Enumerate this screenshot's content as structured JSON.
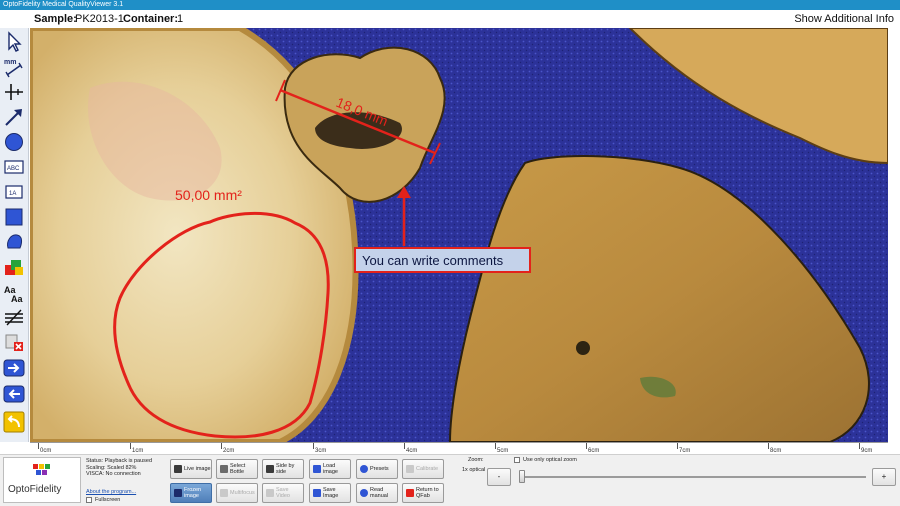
{
  "window": {
    "title": "OptoFidelity Medical QualityViewer 3.1"
  },
  "info": {
    "sample_label": "Sample:",
    "sample_value": "PK2013-1",
    "container_label": "Container:",
    "container_value": "1",
    "show_info": "Show Additional Info"
  },
  "toolbar": {
    "items": [
      {
        "icon": "pointer-icon"
      },
      {
        "icon": "measure-line-icon",
        "text": "mm"
      },
      {
        "icon": "crosshair-icon"
      },
      {
        "icon": "arrow-icon"
      },
      {
        "icon": "circle-icon"
      },
      {
        "icon": "text-box-icon",
        "text": "ABC"
      },
      {
        "icon": "label-icon",
        "text": "1A"
      },
      {
        "icon": "rectangle-icon"
      },
      {
        "icon": "freeform-icon"
      },
      {
        "icon": "layers-icon"
      },
      {
        "icon": "font-size-icon",
        "text": "Aa"
      },
      {
        "icon": "hatch-icon"
      },
      {
        "icon": "delete-icon"
      },
      {
        "icon": "forward-icon"
      },
      {
        "icon": "back-icon"
      },
      {
        "icon": "undo-icon"
      }
    ]
  },
  "annotations": {
    "area": "50,00 mm²",
    "length": "18,0 mm",
    "comment": "You can write comments"
  },
  "ruler": {
    "labels": [
      "0cm",
      "1cm",
      "2cm",
      "3cm",
      "4cm",
      "5cm",
      "6cm",
      "7cm",
      "8cm",
      "9cm"
    ]
  },
  "status": {
    "line1": "Status: Playback is paused",
    "line2": "Scaling: Scaled 82%",
    "line3": "VISCA: No connection",
    "about": "About the program...",
    "fullscreen": "Fullscreen"
  },
  "logo": {
    "text": "OptoFidelity"
  },
  "buttons": {
    "live_image": "Live image",
    "select_bottle": "Select Bottle",
    "side_by_side": "Side by side",
    "load_image": "Load image",
    "presets": "Presets",
    "calibrate": "Calibrate",
    "frozen_image": "Frozen image",
    "multifocus": "Multifocus",
    "save_video": "Save Video",
    "save_image": "Save Image",
    "read_manual": "Read manual",
    "return_qfab": "Return to QFab"
  },
  "zoom": {
    "label": "Zoom:",
    "value": "1x optical",
    "optical_only": "Use only optical zoom",
    "minus": "-",
    "plus": "+",
    "level": 0
  },
  "colors": {
    "titlebar": "#1f8fc7",
    "annotation": "#e3221b",
    "background": "#2b2f9a"
  }
}
